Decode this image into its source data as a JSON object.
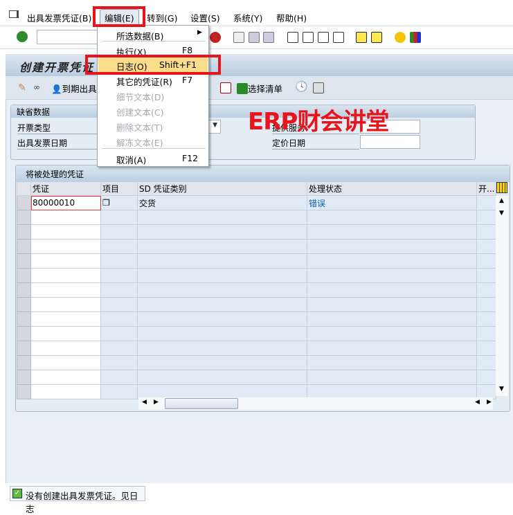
{
  "menubar": {
    "items": [
      "出具发票凭证(B)",
      "编辑(E)",
      "转到(G)",
      "设置(S)",
      "系统(Y)",
      "帮助(H)"
    ]
  },
  "screen_title": "创建开票凭证",
  "app_toolbar": {
    "due_billing": "到期出具",
    "select_list": "选择清单"
  },
  "edit_menu": {
    "items": [
      {
        "label": "所选数据(B)",
        "key": "",
        "enabled": true,
        "submenu": true
      },
      {
        "label": "执行(X)",
        "key": "F8",
        "enabled": true
      },
      {
        "label": "日志(O)",
        "key": "Shift+F1",
        "enabled": true,
        "highlighted": true
      },
      {
        "label": "其它的凭证(R)",
        "key": "F7",
        "enabled": true
      },
      {
        "label": "细节文本(D)",
        "key": "",
        "enabled": false
      },
      {
        "label": "创建文本(C)",
        "key": "",
        "enabled": false
      },
      {
        "label": "删除文本(T)",
        "key": "",
        "enabled": false
      },
      {
        "label": "解冻文本(E)",
        "key": "",
        "enabled": false
      },
      {
        "label": "取消(A)",
        "key": "F12",
        "enabled": true
      }
    ]
  },
  "defaults": {
    "title": "缺省数据",
    "billing_type": "开票类型",
    "billing_date": "出具发票日期",
    "service_date": "提供服务",
    "pricing_date": "定价日期"
  },
  "watermark": "ERP财会讲堂",
  "docs": {
    "title": "将被处理的凭证",
    "columns": [
      "凭证",
      "项目",
      "SD 凭证类别",
      "处理状态",
      "开..."
    ],
    "rows": [
      {
        "doc": "80000010",
        "item": "",
        "category": "交货",
        "status": "错误"
      }
    ]
  },
  "status_message": "没有创建出具发票凭证。见日志",
  "colors": {
    "highlight": "#fbdc8a",
    "annotation": "#e8141c",
    "status_link": "#0a5eb0"
  }
}
